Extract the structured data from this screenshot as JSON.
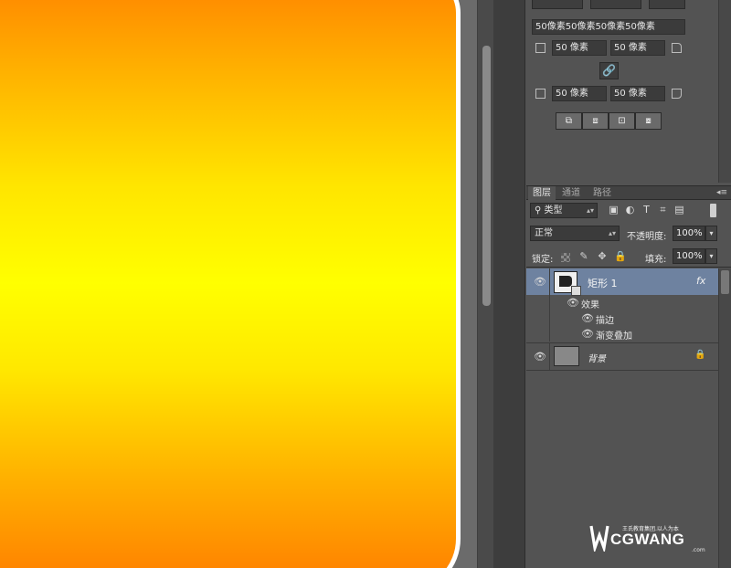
{
  "properties": {
    "size_field": "50像素50像素50像素50像素",
    "corner_top_left": "50 像素",
    "corner_top_right": "50 像素",
    "corner_bottom_left": "50 像素",
    "corner_bottom_right": "50 像素",
    "link_icon": "🔗",
    "path_ops": [
      "⧉",
      "⧈",
      "⊡",
      "⧇"
    ]
  },
  "layers_panel": {
    "tabs": [
      "图层",
      "通道",
      "路径"
    ],
    "menu_icon": "◂≡",
    "filter_kind": "类型",
    "filter_icons": [
      "▣",
      "◐",
      "T",
      "⌗",
      "▤"
    ],
    "blend_mode": "正常",
    "opacity_label": "不透明度:",
    "opacity_value": "100%",
    "lock_label": "锁定:",
    "fill_label": "填充:",
    "fill_value": "100%",
    "layers": [
      {
        "name": "矩形 1",
        "fx": "fx",
        "effects_label": "效果",
        "effects": [
          "描边",
          "渐变叠加"
        ]
      },
      {
        "name": "背景"
      }
    ]
  },
  "watermark": {
    "tagline": "王氏教育集团.以人为本",
    "brand": "CGWANG",
    "domain": ".com"
  },
  "colors": {
    "gradient_top": "#ff8400",
    "gradient_mid": "#ffff00",
    "gradient_bottom": "#ff7c00",
    "selected_layer": "#6e82a0"
  }
}
